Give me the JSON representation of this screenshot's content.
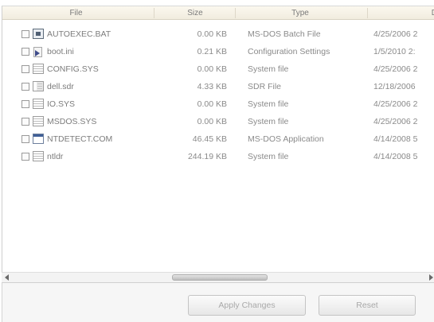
{
  "columns": [
    {
      "key": "file",
      "label": "File"
    },
    {
      "key": "size",
      "label": "Size"
    },
    {
      "key": "type",
      "label": "Type"
    },
    {
      "key": "date",
      "label": "D"
    }
  ],
  "files": [
    {
      "name": "AUTOEXEC.BAT",
      "size": "0.00 KB",
      "type": "MS-DOS Batch File",
      "date": "4/25/2006 2",
      "icon": "batch-file-icon",
      "checked": false
    },
    {
      "name": "boot.ini",
      "size": "0.21 KB",
      "type": "Configuration Settings",
      "date": "1/5/2010 2:",
      "icon": "ini-file-icon",
      "checked": false
    },
    {
      "name": "CONFIG.SYS",
      "size": "0.00 KB",
      "type": "System file",
      "date": "4/25/2006 2",
      "icon": "system-file-icon",
      "checked": false
    },
    {
      "name": "dell.sdr",
      "size": "4.33 KB",
      "type": "SDR File",
      "date": "12/18/2006",
      "icon": "data-file-icon",
      "checked": false
    },
    {
      "name": "IO.SYS",
      "size": "0.00 KB",
      "type": "System file",
      "date": "4/25/2006 2",
      "icon": "system-file-icon",
      "checked": false
    },
    {
      "name": "MSDOS.SYS",
      "size": "0.00 KB",
      "type": "System file",
      "date": "4/25/2006 2",
      "icon": "system-file-icon",
      "checked": false
    },
    {
      "name": "NTDETECT.COM",
      "size": "46.45 KB",
      "type": "MS-DOS Application",
      "date": "4/14/2008 5",
      "icon": "application-file-icon",
      "checked": false
    },
    {
      "name": "ntldr",
      "size": "244.19 KB",
      "type": "System file",
      "date": "4/14/2008 5",
      "icon": "system-file-icon",
      "checked": false
    }
  ],
  "buttons": {
    "apply_label": "Apply Changes",
    "reset_label": "Reset"
  },
  "colors": {
    "header_bg": "#f3eee1",
    "text": "#8a8a8a",
    "button_text_disabled": "#a9a9a9"
  }
}
